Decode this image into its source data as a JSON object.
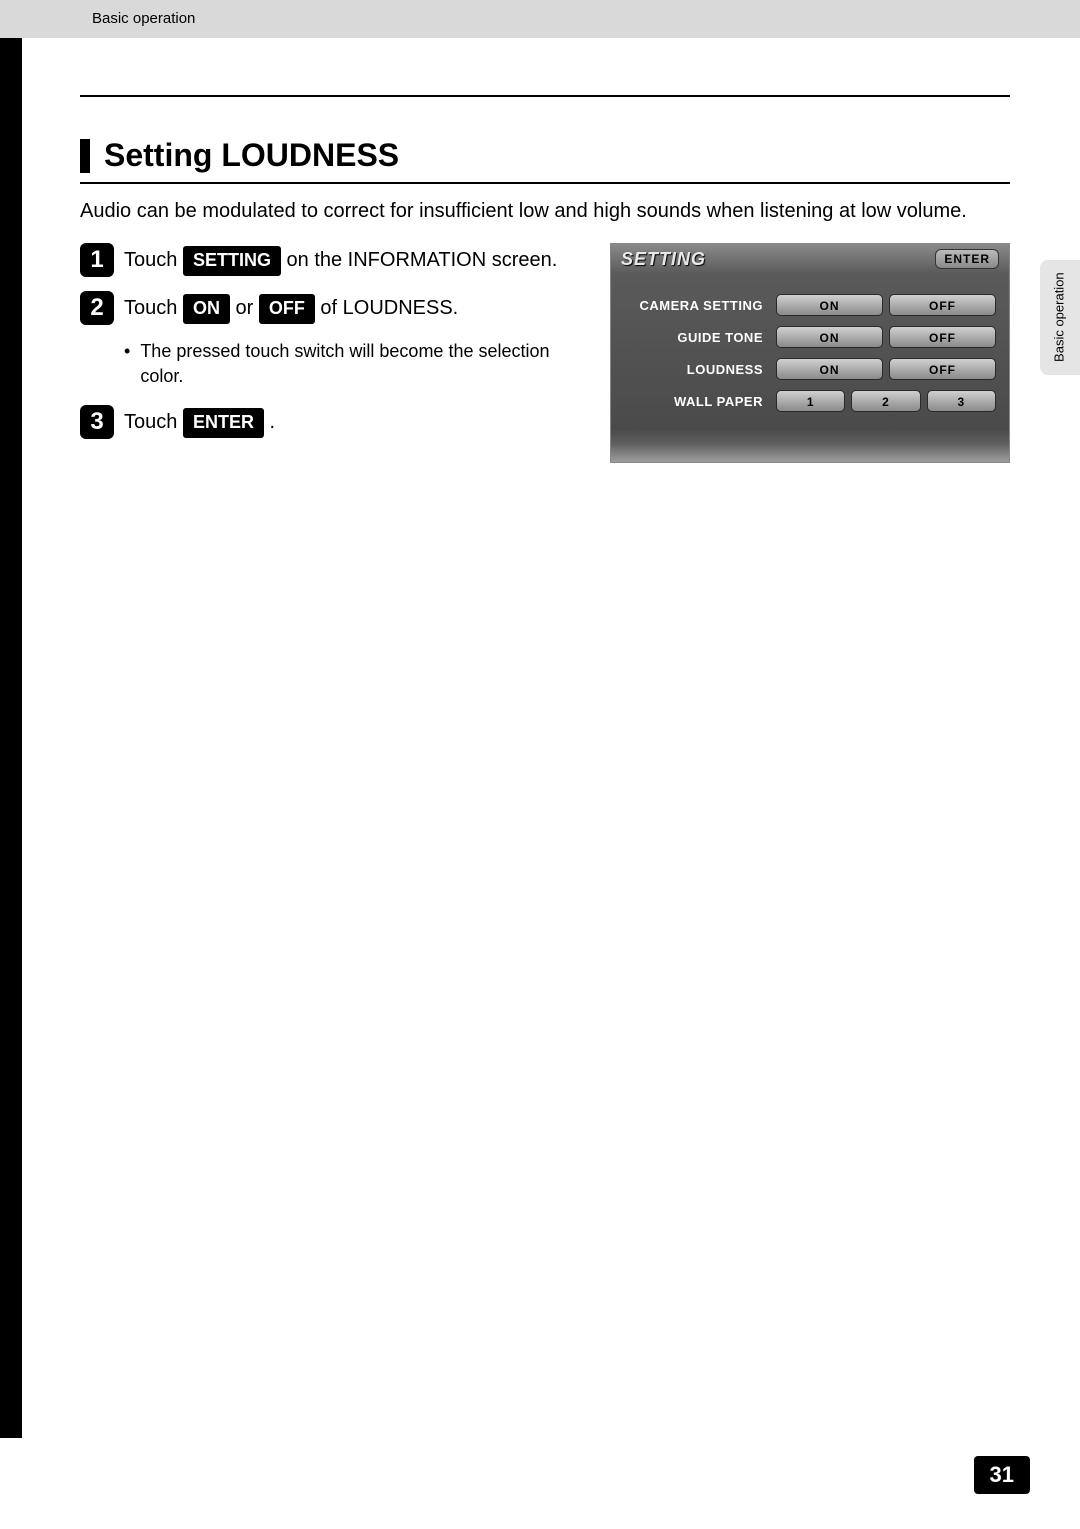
{
  "header": {
    "breadcrumb": "Basic operation"
  },
  "side_tab": {
    "label": "Basic operation"
  },
  "section": {
    "title": "Setting LOUDNESS",
    "intro": "Audio can be modulated to correct for insufficient low and high sounds when listening at low volume."
  },
  "steps": [
    {
      "num": "1",
      "pre": "Touch ",
      "pill": "SETTING",
      "post": " on the INFORMATION screen."
    },
    {
      "num": "2",
      "pre": "Touch ",
      "pill": "ON",
      "mid": " or ",
      "pill2": "OFF",
      "post": " of LOUDNESS.",
      "bullets": [
        "The pressed touch switch will become the selection color."
      ]
    },
    {
      "num": "3",
      "pre": "Touch ",
      "pill": "ENTER",
      "post": " ."
    }
  ],
  "mock": {
    "title": "SETTING",
    "enter": "ENTER",
    "rows": [
      {
        "label": "CAMERA SETTING",
        "opts": [
          "ON",
          "OFF"
        ]
      },
      {
        "label": "GUIDE TONE",
        "opts": [
          "ON",
          "OFF"
        ]
      },
      {
        "label": "LOUDNESS",
        "opts": [
          "ON",
          "OFF"
        ]
      },
      {
        "label": "WALL PAPER",
        "opts": [
          "1",
          "2",
          "3"
        ]
      }
    ]
  },
  "page_number": "31"
}
